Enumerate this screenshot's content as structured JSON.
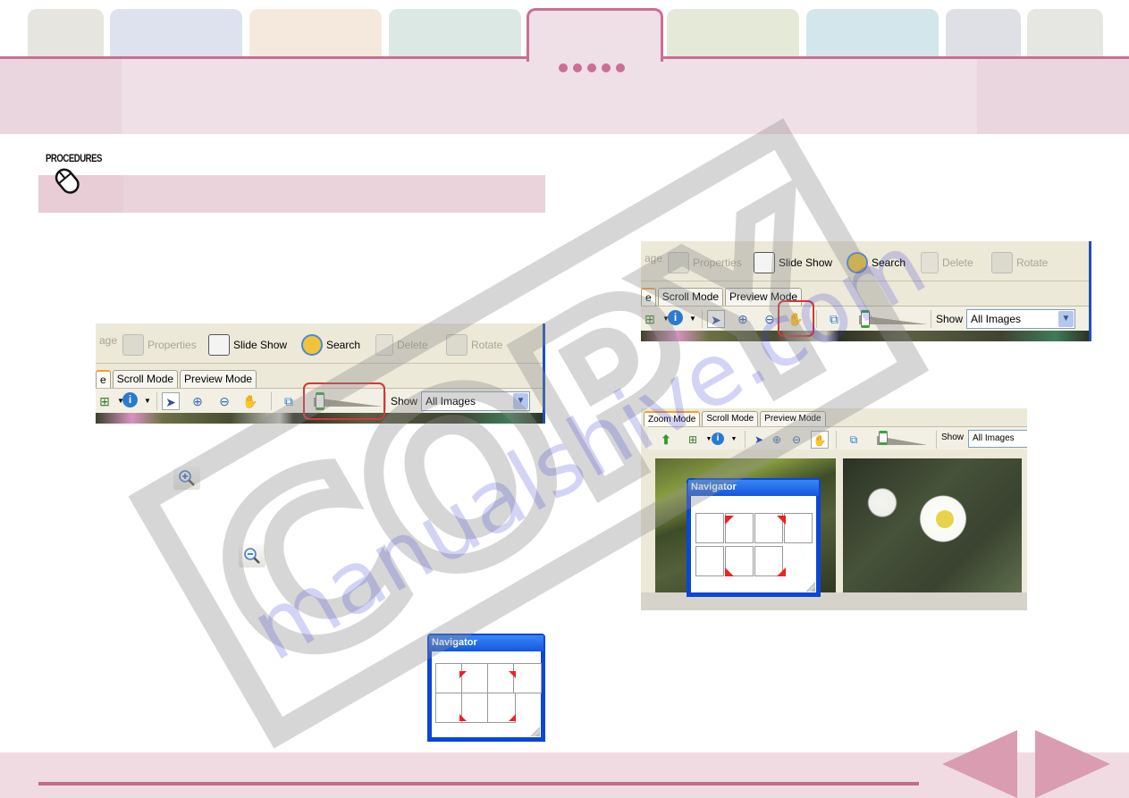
{
  "colors": {
    "accent": "#c96f92",
    "header_bg": "#efdfe7",
    "procedures_bar": "#ebd3db",
    "footer_bg": "#f0dbe3",
    "nav_arrow": "#d99cb1",
    "highlight_box": "#d9343c",
    "tab_colors": [
      "#e6e5e0",
      "#dde2ee",
      "#f5e9de",
      "#dbe8e3",
      "#efdfe7",
      "#e5e9d8",
      "#d2e6ec",
      "#dfdfe6",
      "#e6e6e2"
    ]
  },
  "header": {
    "tabs": [
      {
        "name": "tab-1",
        "active": false
      },
      {
        "name": "tab-2",
        "active": false
      },
      {
        "name": "tab-3",
        "active": false
      },
      {
        "name": "tab-4",
        "active": false
      },
      {
        "name": "tab-5",
        "active": true
      },
      {
        "name": "tab-6",
        "active": false
      },
      {
        "name": "tab-7",
        "active": false
      },
      {
        "name": "tab-8",
        "active": false
      },
      {
        "name": "tab-9",
        "active": false
      }
    ],
    "page_dots": 5
  },
  "procedures": {
    "label": "PROCEDURES",
    "icon": "mouse-icon"
  },
  "screenshot_toolbar": {
    "items": [
      {
        "label": "age",
        "icon": "image-icon",
        "enabled": false
      },
      {
        "label": "Properties",
        "icon": "properties-icon",
        "enabled": false
      },
      {
        "label": "Slide Show",
        "icon": "slideshow-icon",
        "enabled": true
      },
      {
        "label": "Search",
        "icon": "search-icon",
        "enabled": true
      },
      {
        "label": "Delete",
        "icon": "trash-icon",
        "enabled": false
      },
      {
        "label": "Rotate",
        "icon": "rotate-icon",
        "enabled": false
      }
    ],
    "mode_tabs": [
      "Zoom Mode",
      "Scroll Mode",
      "Preview Mode"
    ],
    "mode_tab_partial": "e",
    "show_label": "Show",
    "show_value": "All Images"
  },
  "screenshot1": {
    "highlight": "zoom-slider"
  },
  "screenshot2": {
    "highlight": "hand-tool"
  },
  "screenshot3": {
    "active_mode": "Zoom Mode",
    "hand_tool_active": true
  },
  "inline_icons": {
    "zoom_in": "zoom-in-icon",
    "zoom_out": "zoom-out-icon"
  },
  "navigator": {
    "title": "Navigator"
  },
  "watermark": {
    "stamp": "COPY",
    "site": "manualshive.com"
  },
  "footer": {
    "prev_label": "previous-page",
    "next_label": "next-page"
  }
}
